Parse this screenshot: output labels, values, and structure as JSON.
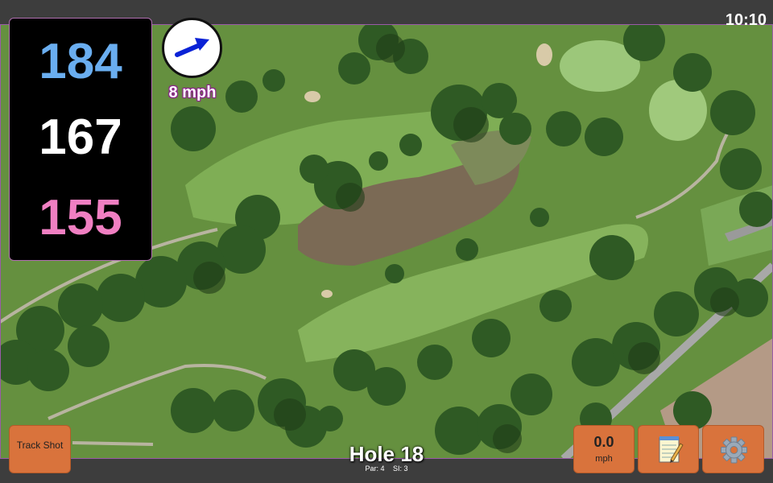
{
  "status_bar": {
    "time": "10:10"
  },
  "distances": {
    "front": "184",
    "middle": "167",
    "back": "155"
  },
  "wind": {
    "speed_label": "8 mph",
    "icon": "wind-direction-arrow-icon"
  },
  "hole": {
    "title": "Hole 18",
    "par_label": "Par: 4",
    "si_label": "SI: 3"
  },
  "buttons": {
    "track_shot": "Track Shot",
    "speed_value": "0.0",
    "speed_unit": "mph",
    "notes_icon": "notepad-icon",
    "settings_icon": "gear-icon"
  },
  "colors": {
    "front_distance": "#6aaef0",
    "middle_distance": "#ffffff",
    "back_distance": "#f07fc2",
    "button_accent": "#d9733c",
    "wind_text_outline": "#8a1f8a"
  }
}
